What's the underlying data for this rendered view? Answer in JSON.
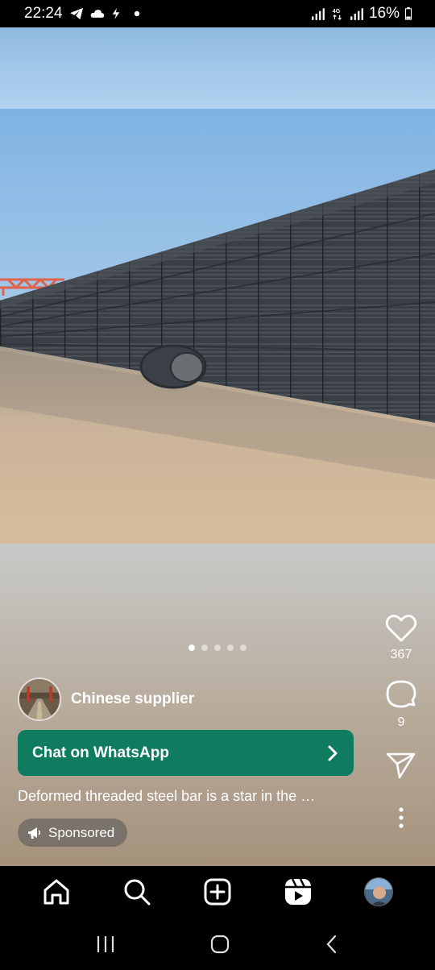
{
  "status_bar": {
    "time": "22:24",
    "left_icons": [
      "telegram-icon",
      "cloud-icon",
      "bolt-icon",
      "dot-icon"
    ],
    "right_icons": [
      "signal-icon",
      "4g-icon",
      "signal-icon"
    ],
    "battery": "16%"
  },
  "post": {
    "carousel": {
      "count": 5,
      "active_index": 0
    },
    "account_name": "Chinese supplier",
    "cta_label": "Chat on WhatsApp",
    "caption": "Deformed threaded steel bar is a star in the …",
    "sponsored_label": "Sponsored"
  },
  "actions": {
    "like_count": "367",
    "comment_count": "9",
    "icons": [
      "heart-icon",
      "comment-icon",
      "share-icon",
      "more-icon"
    ]
  },
  "bottom_nav": {
    "items": [
      "home-icon",
      "search-icon",
      "create-icon",
      "reels-icon",
      "profile-avatar"
    ]
  },
  "system_nav": {
    "items": [
      "recents-icon",
      "home-circle-icon",
      "back-icon"
    ]
  },
  "colors": {
    "cta_bg": "#0f7b5f",
    "status_bg": "#000000",
    "nav_bg": "#000000"
  }
}
